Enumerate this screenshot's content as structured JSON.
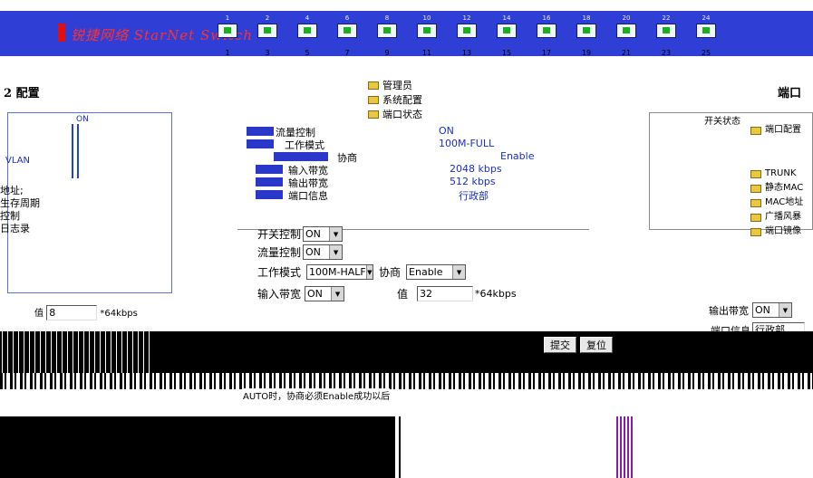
{
  "banner": {
    "logo_text": "锐捷网络 StarNet Switch",
    "top_port_numbers": [
      "1",
      "2",
      "4",
      "6",
      "8",
      "10",
      "12",
      "14",
      "16",
      "18",
      "20",
      "22",
      "24"
    ],
    "bottom_port_numbers": [
      "1",
      "3",
      "5",
      "7",
      "9",
      "11",
      "13",
      "15",
      "17",
      "19",
      "21",
      "23",
      "25"
    ],
    "colors": {
      "strip": "#2f3fd6",
      "port_up": "#15b315"
    }
  },
  "left": {
    "heading": "2 配置",
    "on_label": "ON",
    "vlan_label": "VLAN",
    "lines": [
      "地址;",
      "生存周期",
      "控制",
      "日志录"
    ],
    "value_label": "值",
    "value": "8",
    "unit": "*64kbps"
  },
  "menu": {
    "items": [
      {
        "label": "管理员",
        "icon": "folder-icon"
      },
      {
        "label": "系统配置",
        "icon": "folder-icon"
      },
      {
        "label": "端口状态",
        "icon": "folder-icon"
      }
    ]
  },
  "status_table": {
    "rows": [
      {
        "label": "流量控制",
        "value": "ON"
      },
      {
        "label": "工作模式",
        "value": "100M-FULL"
      },
      {
        "label": "协商",
        "value": "Enable"
      },
      {
        "label": "输入带宽",
        "value": "2048 kbps"
      },
      {
        "label": "输出带宽",
        "value": "512 kbps"
      },
      {
        "label": "端口信息",
        "value": "行政部"
      }
    ]
  },
  "form": {
    "switch_label": "开关控制",
    "switch_value": "ON",
    "flow_label": "流量控制",
    "flow_value": "ON",
    "mode_label": "工作模式",
    "mode_value": "100M-HALF",
    "nego_label": "协商",
    "nego_value": "Enable",
    "in_bw_label": "输入带宽",
    "in_bw_value": "ON",
    "value_label": "值",
    "value": "32",
    "unit": "*64kbps"
  },
  "right": {
    "heading": "端口",
    "panel_title": "开关状态",
    "tree": [
      "端口配置",
      "TRUNK",
      "静态MAC",
      "MAC地址",
      "广播风暴",
      "端口镜像"
    ],
    "out_bw_label": "输出带宽",
    "out_bw_value": "ON",
    "port_info_label": "端口信息",
    "port_info_value": "行政部"
  },
  "actions": {
    "submit": "提交",
    "reset": "复位"
  },
  "note": "AUTO时，协商必须Enable成功以后"
}
